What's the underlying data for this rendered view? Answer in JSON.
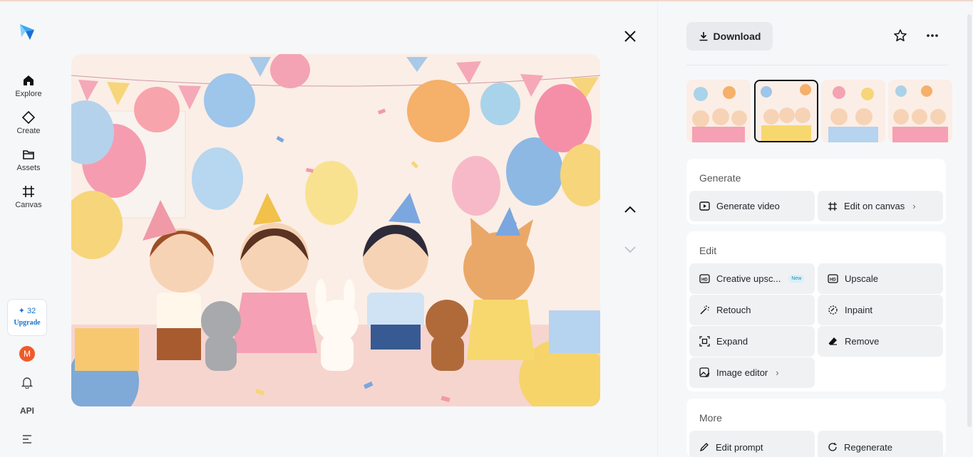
{
  "rail": {
    "nav": [
      {
        "label": "Explore",
        "icon": "home-icon"
      },
      {
        "label": "Create",
        "icon": "diamond-icon"
      },
      {
        "label": "Assets",
        "icon": "folder-icon"
      },
      {
        "label": "Canvas",
        "icon": "canvas-grid-icon"
      }
    ],
    "upgrade": {
      "credits": "32",
      "label": "Upgrade"
    },
    "avatar_initial": "M",
    "api_label": "API"
  },
  "viewer": {
    "image_description_icon": "party-illustration"
  },
  "panel": {
    "download_label": "Download",
    "sections": {
      "generate": {
        "title": "Generate",
        "actions": [
          {
            "label": "Generate video",
            "icon": "play-icon"
          },
          {
            "label": "Edit on canvas",
            "icon": "canvas-grid-icon",
            "chevron": "›"
          }
        ]
      },
      "edit": {
        "title": "Edit",
        "actions": [
          {
            "label": "Creative upsc...",
            "icon": "hd-icon",
            "badge": "New"
          },
          {
            "label": "Upscale",
            "icon": "hd-icon"
          },
          {
            "label": "Retouch",
            "icon": "magic-wand-icon"
          },
          {
            "label": "Inpaint",
            "icon": "inpaint-icon"
          },
          {
            "label": "Expand",
            "icon": "expand-icon"
          },
          {
            "label": "Remove",
            "icon": "eraser-icon"
          },
          {
            "label": "Image editor",
            "icon": "image-edit-icon",
            "chevron": "›"
          }
        ]
      },
      "more": {
        "title": "More",
        "actions": [
          {
            "label": "Edit prompt",
            "icon": "edit-icon"
          },
          {
            "label": "Regenerate",
            "icon": "refresh-icon"
          }
        ]
      }
    }
  },
  "colors": {
    "accent": "#1a73c8",
    "avatar": "#ef5a2b",
    "button_bg": "#e8eaed",
    "action_bg": "#f0f1f3"
  }
}
